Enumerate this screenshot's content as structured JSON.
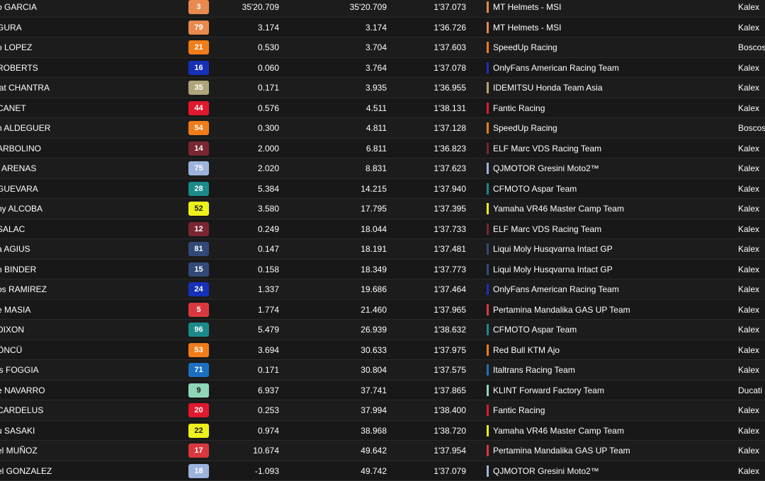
{
  "columns": [
    "rider",
    "number",
    "gap_to_first",
    "gap_to_prev",
    "best_lap",
    "team",
    "bike"
  ],
  "rows": [
    {
      "rider": "o GARCIA",
      "num": "3",
      "num_bg": "#e8894d",
      "num_fg": "#ffffff",
      "gap": "35'20.709",
      "prev": "35'20.709",
      "best": "1'37.073",
      "team": "MT Helmets - MSI",
      "team_color": "#e8894d",
      "bike": "Kalex"
    },
    {
      "rider": "GURA",
      "num": "79",
      "num_bg": "#e8894d",
      "num_fg": "#ffffff",
      "gap": "3.174",
      "prev": "3.174",
      "best": "1'36.726",
      "team": "MT Helmets - MSI",
      "team_color": "#e8894d",
      "bike": "Kalex"
    },
    {
      "rider": "o LOPEZ",
      "num": "21",
      "num_bg": "#f07c1a",
      "num_fg": "#ffffff",
      "gap": "0.530",
      "prev": "3.704",
      "best": "1'37.603",
      "team": "SpeedUp Racing",
      "team_color": "#f07c1a",
      "bike": "Boscos"
    },
    {
      "rider": "ROBERTS",
      "num": "16",
      "num_bg": "#1730b8",
      "num_fg": "#ffffff",
      "gap": "0.060",
      "prev": "3.764",
      "best": "1'37.078",
      "team": "OnlyFans American Racing Team",
      "team_color": "#1730b8",
      "bike": "Kalex"
    },
    {
      "rider": "iat CHANTRA",
      "num": "35",
      "num_bg": "#b0a57a",
      "num_fg": "#ffffff",
      "gap": "0.171",
      "prev": "3.935",
      "best": "1'36.955",
      "team": "IDEMITSU Honda Team Asia",
      "team_color": "#b0a57a",
      "bike": "Kalex"
    },
    {
      "rider": "CANET",
      "num": "44",
      "num_bg": "#e0192f",
      "num_fg": "#ffffff",
      "gap": "0.576",
      "prev": "4.511",
      "best": "1'38.131",
      "team": "Fantic Racing",
      "team_color": "#e0192f",
      "bike": "Kalex"
    },
    {
      "rider": "n ALDEGUER",
      "num": "54",
      "num_bg": "#f07c1a",
      "num_fg": "#ffffff",
      "gap": "0.300",
      "prev": "4.811",
      "best": "1'37.128",
      "team": "SpeedUp Racing",
      "team_color": "#f07c1a",
      "bike": "Boscos"
    },
    {
      "rider": "ARBOLINO",
      "num": "14",
      "num_bg": "#7a2632",
      "num_fg": "#ffffff",
      "gap": "2.000",
      "prev": "6.811",
      "best": "1'36.823",
      "team": "ELF Marc VDS Racing Team",
      "team_color": "#7a2632",
      "bike": "Kalex"
    },
    {
      "rider": "t ARENAS",
      "num": "75",
      "num_bg": "#9cb3dc",
      "num_fg": "#ffffff",
      "gap": "2.020",
      "prev": "8.831",
      "best": "1'37.623",
      "team": "QJMOTOR Gresini Moto2™",
      "team_color": "#9cb3dc",
      "bike": "Kalex"
    },
    {
      "rider": "GUEVARA",
      "num": "28",
      "num_bg": "#1b8a8a",
      "num_fg": "#ffffff",
      "gap": "5.384",
      "prev": "14.215",
      "best": "1'37.940",
      "team": "CFMOTO Aspar Team",
      "team_color": "#1b8a8a",
      "bike": "Kalex"
    },
    {
      "rider": "ny ALCOBA",
      "num": "52",
      "num_bg": "#eef01b",
      "num_fg": "#1a1a1a",
      "gap": "3.580",
      "prev": "17.795",
      "best": "1'37.395",
      "team": "Yamaha VR46 Master Camp Team",
      "team_color": "#eef01b",
      "bike": "Kalex"
    },
    {
      "rider": "SALAC",
      "num": "12",
      "num_bg": "#7a2632",
      "num_fg": "#ffffff",
      "gap": "0.249",
      "prev": "18.044",
      "best": "1'37.733",
      "team": "ELF Marc VDS Racing Team",
      "team_color": "#7a2632",
      "bike": "Kalex"
    },
    {
      "rider": "a AGIUS",
      "num": "81",
      "num_bg": "#334a78",
      "num_fg": "#ffffff",
      "gap": "0.147",
      "prev": "18.191",
      "best": "1'37.481",
      "team": "Liqui Moly Husqvarna Intact GP",
      "team_color": "#334a78",
      "bike": "Kalex"
    },
    {
      "rider": "n BINDER",
      "num": "15",
      "num_bg": "#334a78",
      "num_fg": "#ffffff",
      "gap": "0.158",
      "prev": "18.349",
      "best": "1'37.773",
      "team": "Liqui Moly Husqvarna Intact GP",
      "team_color": "#334a78",
      "bike": "Kalex"
    },
    {
      "rider": "os RAMIREZ",
      "num": "24",
      "num_bg": "#1730b8",
      "num_fg": "#ffffff",
      "gap": "1.337",
      "prev": "19.686",
      "best": "1'37.464",
      "team": "OnlyFans American Racing Team",
      "team_color": "#1730b8",
      "bike": "Kalex"
    },
    {
      "rider": "e MASIA",
      "num": "5",
      "num_bg": "#d9383f",
      "num_fg": "#ffffff",
      "gap": "1.774",
      "prev": "21.460",
      "best": "1'37.965",
      "team": "Pertamina Mandalika GAS UP Team",
      "team_color": "#d9383f",
      "bike": "Kalex"
    },
    {
      "rider": "DIXON",
      "num": "96",
      "num_bg": "#1b8a8a",
      "num_fg": "#ffffff",
      "gap": "5.479",
      "prev": "26.939",
      "best": "1'38.632",
      "team": "CFMOTO Aspar Team",
      "team_color": "#1b8a8a",
      "bike": "Kalex"
    },
    {
      "rider": "ÖNCÜ",
      "num": "53",
      "num_bg": "#f07c1a",
      "num_fg": "#ffffff",
      "gap": "3.694",
      "prev": "30.633",
      "best": "1'37.975",
      "team": "Red Bull KTM Ajo",
      "team_color": "#f07c1a",
      "bike": "Kalex"
    },
    {
      "rider": "is FOGGIA",
      "num": "71",
      "num_bg": "#1a6fc0",
      "num_fg": "#ffffff",
      "gap": "0.171",
      "prev": "30.804",
      "best": "1'37.575",
      "team": "Italtrans Racing Team",
      "team_color": "#1a6fc0",
      "bike": "Kalex"
    },
    {
      "rider": "e NAVARRO",
      "num": "9",
      "num_bg": "#8fd6b8",
      "num_fg": "#1a1a1a",
      "gap": "6.937",
      "prev": "37.741",
      "best": "1'37.865",
      "team": "KLINT Forward Factory Team",
      "team_color": "#8fd6b8",
      "bike": "Ducati"
    },
    {
      "rider": "CARDELUS",
      "num": "20",
      "num_bg": "#e0192f",
      "num_fg": "#ffffff",
      "gap": "0.253",
      "prev": "37.994",
      "best": "1'38.400",
      "team": "Fantic Racing",
      "team_color": "#e0192f",
      "bike": "Kalex"
    },
    {
      "rider": "u SASAKI",
      "num": "22",
      "num_bg": "#eef01b",
      "num_fg": "#1a1a1a",
      "gap": "0.974",
      "prev": "38.968",
      "best": "1'38.720",
      "team": "Yamaha VR46 Master Camp Team",
      "team_color": "#eef01b",
      "bike": "Kalex"
    },
    {
      "rider": "el MUÑOZ",
      "num": "17",
      "num_bg": "#d9383f",
      "num_fg": "#ffffff",
      "gap": "10.674",
      "prev": "49.642",
      "best": "1'37.954",
      "team": "Pertamina Mandalika GAS UP Team",
      "team_color": "#d9383f",
      "bike": "Kalex"
    },
    {
      "rider": "el GONZALEZ",
      "num": "18",
      "num_bg": "#9cb3dc",
      "num_fg": "#ffffff",
      "gap": "-1.093",
      "prev": "49.742",
      "best": "1'37.079",
      "team": "QJMOTOR Gresini Moto2™",
      "team_color": "#9cb3dc",
      "bike": "Kalex"
    }
  ]
}
